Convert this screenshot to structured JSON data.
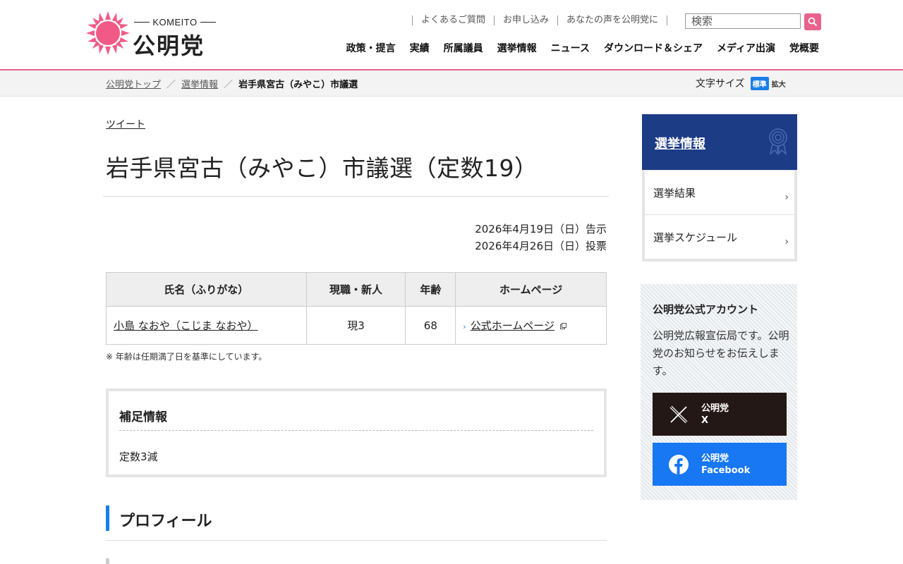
{
  "brand": {
    "komeito": "KOMEITO",
    "name": "公明党",
    "sun_color": "#f15a87"
  },
  "utility_links": [
    "よくあるご質問",
    "お申し込み",
    "あなたの声を公明党に"
  ],
  "search": {
    "placeholder": "検索"
  },
  "global_nav": [
    "政策・提言",
    "実績",
    "所属議員",
    "選挙情報",
    "ニュース",
    "ダウンロード＆シェア",
    "メディア出演",
    "党概要"
  ],
  "breadcrumb": {
    "items": [
      "公明党トップ",
      "選挙情報"
    ],
    "current": "岩手県宮古（みやこ）市議選"
  },
  "font_size": {
    "label": "文字サイズ",
    "standard": "標準",
    "large": "拡大"
  },
  "tweet": "ツイート",
  "page_title": "岩手県宮古（みやこ）市議選（定数19）",
  "dates": {
    "announcement": "2026年4月19日（日）告示",
    "vote": "2026年4月26日（日）投票"
  },
  "candidates": {
    "headers": [
      "氏名（ふりがな）",
      "現職・新人",
      "年齢",
      "ホームページ"
    ],
    "rows": [
      {
        "name": "小島 なおや（こじま なおや）",
        "status": "現3",
        "age": "68",
        "homepage": "公式ホームページ"
      }
    ]
  },
  "note": "※ 年齢は任期満了日を基準にしています。",
  "supplementary": {
    "title": "補足情報",
    "text": "定数3減"
  },
  "profile": {
    "title": "プロフィール"
  },
  "sidebar": {
    "title": "選挙情報",
    "items": [
      "選挙結果",
      "選挙スケジュール"
    ],
    "accent": "#1d3c86"
  },
  "sns": {
    "title": "公明党公式アカウント",
    "text": "公明党広報宣伝局です。公明党のお知らせをお伝えします。",
    "x": {
      "line1": "公明党",
      "line2": "X"
    },
    "facebook": {
      "line1": "公明党",
      "line2": "Facebook"
    }
  },
  "colors": {
    "pink": "#e8628c",
    "blue": "#1a7ee8",
    "navy": "#1d3c86",
    "x_black": "#231815",
    "facebook_blue": "#1877f2"
  }
}
